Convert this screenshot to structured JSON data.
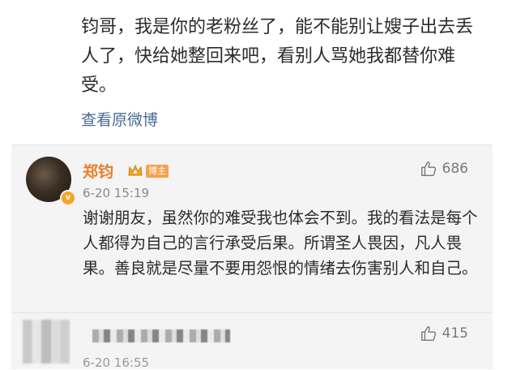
{
  "post": {
    "text": "钧哥，我是你的老粉丝了，能不能别让嫂子出去丢人了，快给她整回来吧，看别人骂她我都替你难受。",
    "view_original": "查看原微博"
  },
  "comments": [
    {
      "username": "郑钧",
      "badge": "博主",
      "timestamp": "6-20 15:19",
      "likes": "686",
      "text": "谢谢朋友，虽然你的难受我也体会不到。我的看法是每个人都得为自己的言行承受后果。所谓圣人畏因，凡人畏果。善良就是尽量不要用怨恨的情绪去伤害别人和自己。"
    },
    {
      "timestamp": "6-20 16:55",
      "likes": "415"
    }
  ],
  "icons": {
    "like": "thumb-up-icon",
    "vip": "crown-icon"
  },
  "colors": {
    "username": "#e87e2c",
    "link": "#4a6c92",
    "badge": "#f6a14b",
    "comment_bg": "#f4f4f4"
  }
}
